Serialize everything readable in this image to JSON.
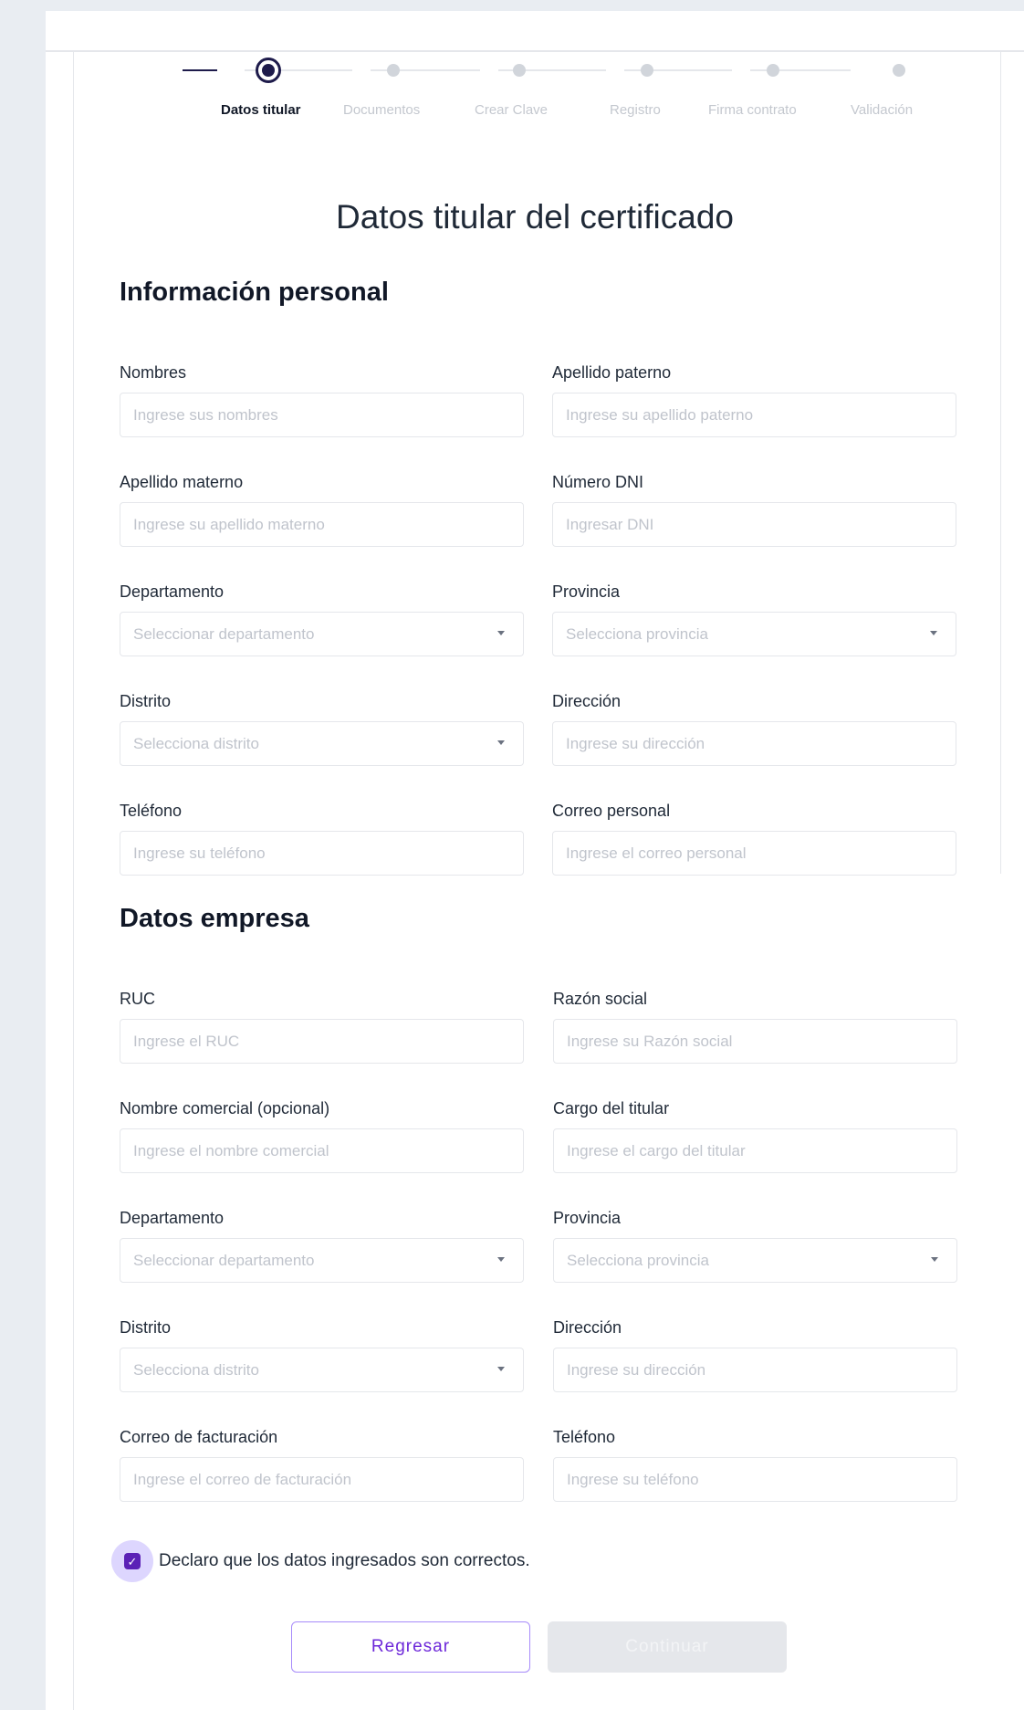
{
  "stepper": {
    "steps": [
      {
        "label": "Datos titular",
        "active": true
      },
      {
        "label": "Documentos",
        "active": false
      },
      {
        "label": "Crear Clave",
        "active": false
      },
      {
        "label": "Registro",
        "active": false
      },
      {
        "label": "Firma contrato",
        "active": false
      },
      {
        "label": "Validación",
        "active": false
      }
    ]
  },
  "title": "Datos titular del certificado",
  "personal": {
    "heading": "Información personal",
    "nombres": {
      "label": "Nombres",
      "placeholder": "Ingrese sus nombres"
    },
    "apellido_paterno": {
      "label": "Apellido paterno",
      "placeholder": "Ingrese su apellido paterno"
    },
    "apellido_materno": {
      "label": "Apellido materno",
      "placeholder": "Ingrese su apellido materno"
    },
    "dni": {
      "label": "Número DNI",
      "placeholder": "Ingresar DNI"
    },
    "departamento": {
      "label": "Departamento",
      "placeholder": "Seleccionar departamento"
    },
    "provincia": {
      "label": "Provincia",
      "placeholder": "Selecciona provincia"
    },
    "distrito": {
      "label": "Distrito",
      "placeholder": "Selecciona distrito"
    },
    "direccion": {
      "label": "Dirección",
      "placeholder": "Ingrese su dirección"
    },
    "telefono": {
      "label": "Teléfono",
      "placeholder": "Ingrese su teléfono"
    },
    "correo": {
      "label": "Correo personal",
      "placeholder": "Ingrese el correo personal"
    }
  },
  "empresa": {
    "heading": "Datos empresa",
    "ruc": {
      "label": "RUC",
      "placeholder": "Ingrese el RUC"
    },
    "razon_social": {
      "label": "Razón social",
      "placeholder": "Ingrese su Razón social"
    },
    "nombre_comercial": {
      "label": "Nombre comercial (opcional)",
      "placeholder": "Ingrese el nombre comercial"
    },
    "cargo": {
      "label": "Cargo del titular",
      "placeholder": "Ingrese el cargo del titular"
    },
    "departamento": {
      "label": "Departamento",
      "placeholder": "Seleccionar departamento"
    },
    "provincia": {
      "label": "Provincia",
      "placeholder": "Selecciona provincia"
    },
    "distrito": {
      "label": "Distrito",
      "placeholder": "Selecciona distrito"
    },
    "direccion": {
      "label": "Dirección",
      "placeholder": "Ingrese su dirección"
    },
    "correo_facturacion": {
      "label": "Correo de facturación",
      "placeholder": "Ingrese el correo de facturación"
    },
    "telefono": {
      "label": "Teléfono",
      "placeholder": "Ingrese su teléfono"
    }
  },
  "declaration": {
    "label": "Declaro que los datos ingresados son correctos.",
    "checked": true
  },
  "buttons": {
    "back": "Regresar",
    "next": "Continuar"
  },
  "colors": {
    "accent": "#5b21b6",
    "step_active": "#1e1b4b",
    "background": "#e9edf2"
  }
}
